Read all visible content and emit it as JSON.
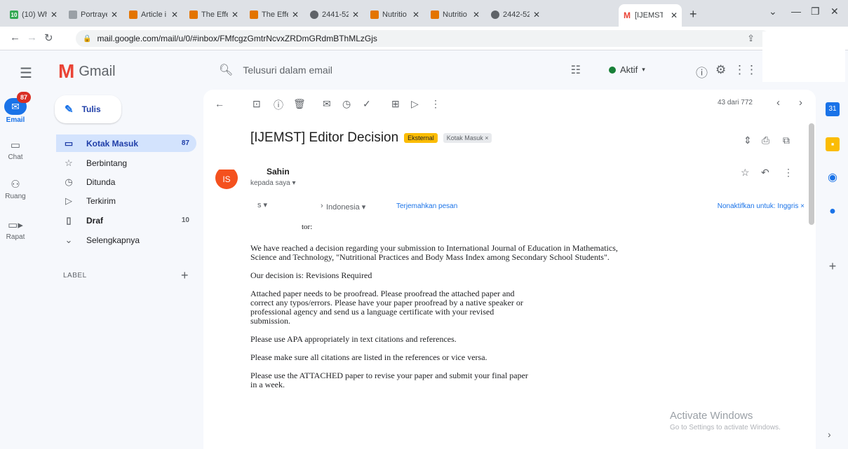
{
  "browser": {
    "tabs": [
      {
        "title": "(10) Wh",
        "favicon_color": "#34a853"
      },
      {
        "title": "Portraye",
        "favicon_color": "#9aa0a6"
      },
      {
        "title": "Article i",
        "favicon_color": "#e37400"
      },
      {
        "title": "The Effe",
        "favicon_color": "#e37400"
      },
      {
        "title": "The Effe",
        "favicon_color": "#e37400"
      },
      {
        "title": "2441-52",
        "favicon_color": "#5f6368"
      },
      {
        "title": "Nutritio",
        "favicon_color": "#e37400"
      },
      {
        "title": "Nutritio",
        "favicon_color": "#e37400"
      },
      {
        "title": "2442-52",
        "favicon_color": "#5f6368"
      },
      {
        "title": "[IJEMST",
        "favicon_color": "#ea4335"
      }
    ],
    "url": "mail.google.com/mail/u/0/#inbox/FMfcgzGmtrNcvxZRDmGRdmBThMLzGjs"
  },
  "gmail": {
    "brand": "Gmail",
    "search_placeholder": "Telusuri dalam email",
    "status": "Aktif"
  },
  "rail": {
    "email_label": "Email",
    "email_badge": "87",
    "chat_label": "Chat",
    "rooms_label": "Ruang",
    "meet_label": "Rapat"
  },
  "sidebar": {
    "compose_label": "Tulis",
    "items": [
      {
        "label": "Kotak Masuk",
        "count": "87",
        "icon": "inbox-icon"
      },
      {
        "label": "Berbintang",
        "count": "",
        "icon": "star-icon"
      },
      {
        "label": "Ditunda",
        "count": "",
        "icon": "clock-icon"
      },
      {
        "label": "Terkirim",
        "count": "",
        "icon": "send-icon"
      },
      {
        "label": "Draf",
        "count": "10",
        "icon": "draft-icon"
      },
      {
        "label": "Selengkapnya",
        "count": "",
        "icon": "chevron-down-icon"
      }
    ],
    "labels_header": "LABEL"
  },
  "message": {
    "pager": "43 dari 772",
    "subject": "[IJEMST] Editor Decision",
    "badge_external": "Eksternal",
    "badge_inbox": "Kotak Masuk ×",
    "avatar_initials": "IS",
    "sender": "Sahin",
    "recipients": "kepada saya ▾",
    "translate_from": "s ▾",
    "translate_to": "Indonesia ▾",
    "translate_link": "Terjemahkan pesan",
    "translate_off": "Nonaktifkan untuk: Inggris ×",
    "greeting": "tor:",
    "paragraphs": [
      "We have reached a decision regarding your submission to International Journal of Education in Mathematics, Science and Technology, \"Nutritional Practices and Body Mass Index among Secondary School Students\".",
      "Our decision is: Revisions Required",
      "Attached paper needs to be proofread. Please proofread the attached paper and correct any typos/errors. Please have your paper proofread by a native speaker or professional agency and send us a language certificate with your revised submission.",
      "Please use APA appropriately in text citations and references.",
      "Please make sure all citations are listed in the references or vice versa.",
      "Please use the ATTACHED paper to revise your paper and submit your final paper in a week."
    ]
  },
  "watermark": {
    "line1": "Activate Windows",
    "line2": "Go to Settings to activate Windows."
  }
}
